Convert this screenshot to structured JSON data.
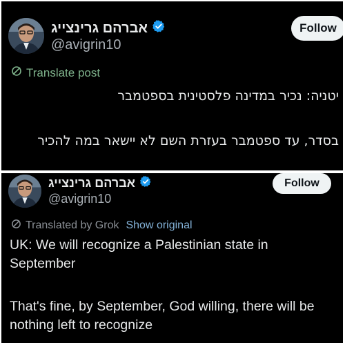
{
  "original_post": {
    "display_name": "אברהם גרינצייג",
    "handle": "@avigrin10",
    "follow_label": "Follow",
    "translate_label": "Translate post",
    "lines": [
      "יטניה: נכיר במדינה פלסטינית בספטמבר",
      "בסדר, עד ספטמבר בעזרת השם לא יישאר במה להכיר"
    ]
  },
  "translated_post": {
    "display_name": "אברהם גרינצייג",
    "handle": "@avigrin10",
    "follow_label": "Follow",
    "translated_by_label": "Translated by Grok",
    "show_original_label": "Show original",
    "paragraphs": [
      "UK: We will recognize a Palestinian state in September",
      "That's fine, by September, God willing, there will be nothing left to recognize"
    ]
  },
  "colors": {
    "background": "#000000",
    "text": "#e7e9ea",
    "handle": "#a9afb5",
    "translate_link": "#7fb38c",
    "show_original": "#84b3d9",
    "verified_badge": "#1d9bf0"
  },
  "icons": [
    "verified-badge-icon",
    "translate-icon"
  ]
}
